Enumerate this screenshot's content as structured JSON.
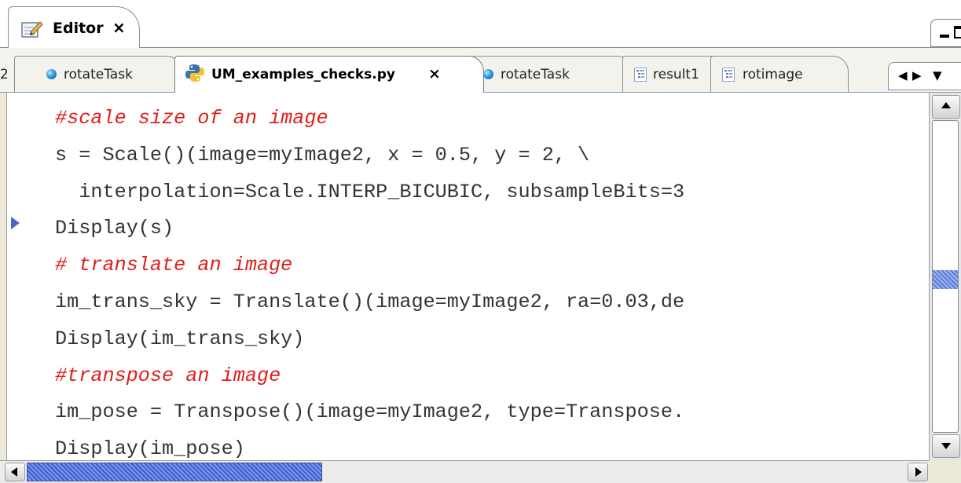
{
  "view_tab": {
    "label": "Editor",
    "close": "×",
    "icon": "editor-pencil-icon"
  },
  "view_controls": {
    "minimize": "minimize-icon",
    "maximize": "maximize-icon"
  },
  "editor_tabs": {
    "overflow_label": "2",
    "tabs": [
      {
        "label": "rotateTask",
        "icon": "blue-dot-icon",
        "active": false
      },
      {
        "label": "UM_examples_checks.py",
        "icon": "python-icon",
        "active": true,
        "close": "×"
      },
      {
        "label": "rotateTask",
        "icon": "blue-dot-icon",
        "active": false
      },
      {
        "label": "result1",
        "icon": "tree-list-icon",
        "active": false
      },
      {
        "label": "rotimage",
        "icon": "tree-list-icon",
        "active": false
      }
    ],
    "nav": {
      "left": "◀",
      "right": "▶",
      "menu": "▼"
    }
  },
  "code_lines": [
    {
      "text": "#scale size of an image",
      "comment": true
    },
    {
      "text": "s = Scale()(image=myImage2, x = 0.5, y = 2, \\",
      "comment": false
    },
    {
      "text": "  interpolation=Scale.INTERP_BICUBIC, subsampleBits=3",
      "comment": false
    },
    {
      "text": "Display(s)",
      "comment": false
    },
    {
      "text": "# translate an image",
      "comment": true
    },
    {
      "text": "im_trans_sky = Translate()(image=myImage2, ra=0.03,de",
      "comment": false
    },
    {
      "text": "Display(im_trans_sky)",
      "comment": false
    },
    {
      "text": "#transpose an image",
      "comment": true
    },
    {
      "text": "im_pose = Transpose()(image=myImage2, type=Transpose.",
      "comment": false
    },
    {
      "text": "Display(im_pose)",
      "comment": false
    }
  ],
  "colors": {
    "comment": "#e0201a",
    "code_text": "#333333",
    "active_tab_bg": "#ffffff",
    "scroll_accent": "#3c5fd1"
  }
}
